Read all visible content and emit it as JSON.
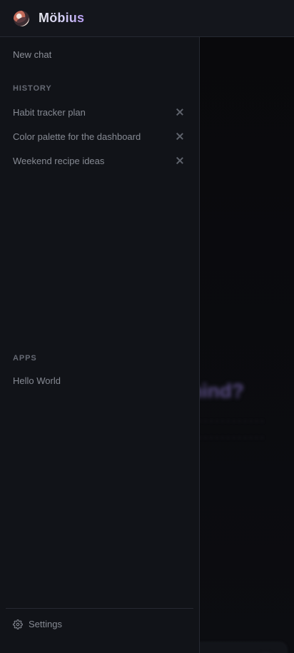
{
  "header": {
    "brand": "Möbius"
  },
  "sidebar": {
    "new_chat": "New chat",
    "history_label": "HISTORY",
    "history": [
      {
        "label": "Habit tracker plan"
      },
      {
        "label": "Color palette for the dashboard"
      },
      {
        "label": "Weekend recipe ideas"
      }
    ],
    "apps_label": "APPS",
    "apps": [
      {
        "label": "Hello World"
      }
    ],
    "settings_label": "Settings"
  },
  "main": {
    "heading_fragment": "mind?"
  },
  "colors": {
    "background": "#0a0a0d",
    "sidebar": "#111318",
    "header": "#14161c",
    "border": "#262932",
    "accent": "#b79cf2"
  },
  "icons": {
    "logo": "mobius-logo",
    "close": "close-icon",
    "settings": "gear-icon"
  }
}
